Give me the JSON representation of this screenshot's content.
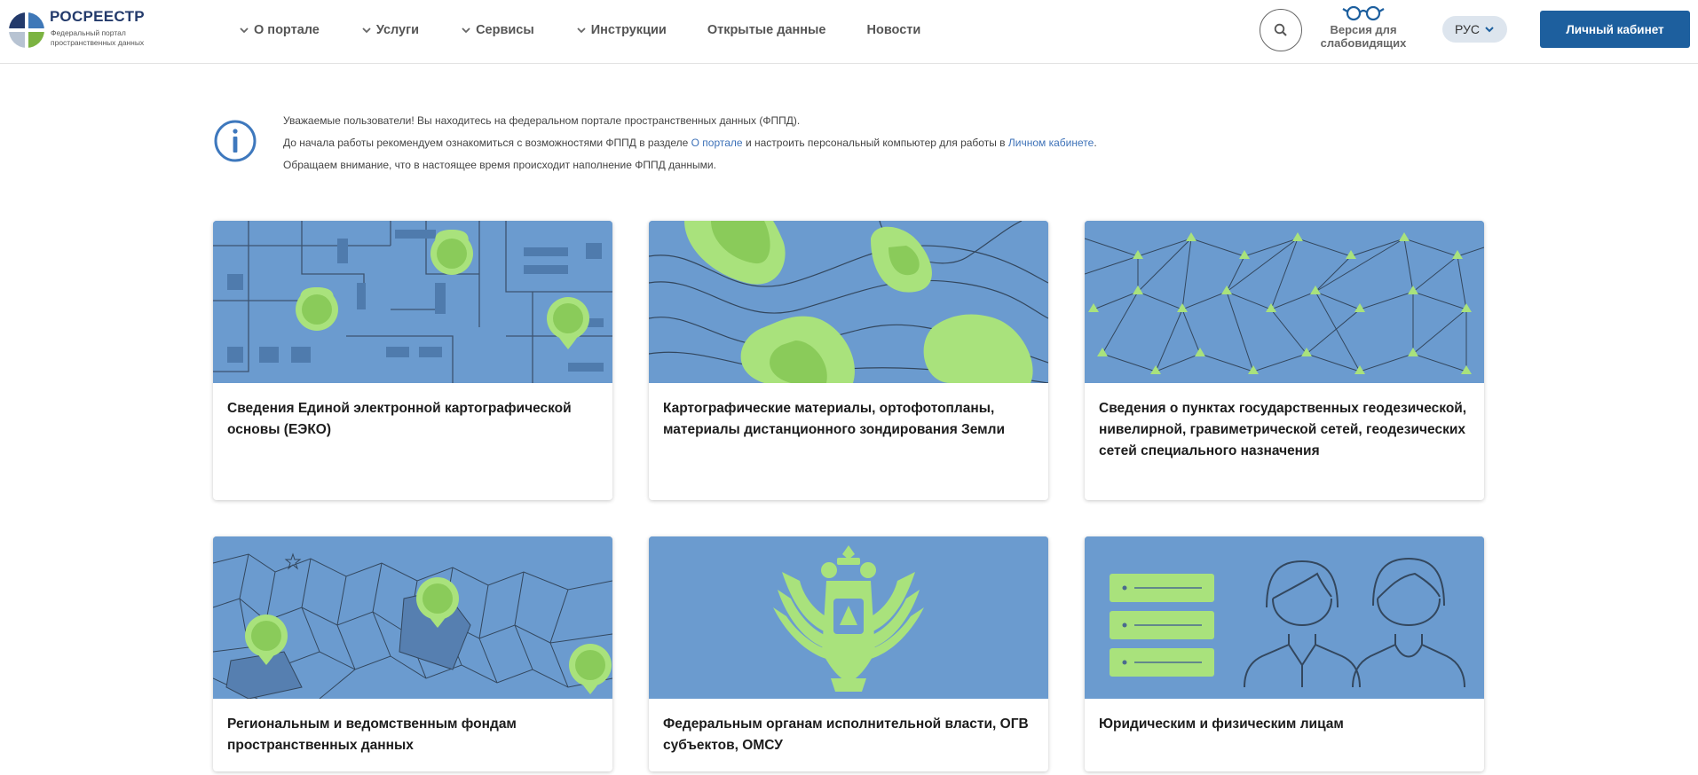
{
  "header": {
    "logo": {
      "title": "РОСРЕЕСТР",
      "subtitle": "Федеральный портал пространственных данных"
    },
    "nav": [
      {
        "label": "О портале",
        "dropdown": true
      },
      {
        "label": "Услуги",
        "dropdown": true
      },
      {
        "label": "Сервисы",
        "dropdown": true
      },
      {
        "label": "Инструкции",
        "dropdown": true
      },
      {
        "label": "Открытые данные",
        "dropdown": false
      },
      {
        "label": "Новости",
        "dropdown": false
      }
    ],
    "vision_label": "Версия для слабовидящих",
    "lang": "РУС",
    "cabinet_label": "Личный кабинет"
  },
  "info": {
    "line1": "Уважаемые пользователи! Вы находитесь на федеральном портале пространственных данных (ФППД).",
    "line2_pre": "До начала работы рекомендуем ознакомиться с возможностями ФППД в разделе ",
    "line2_link1": "О портале",
    "line2_mid": " и настроить персональный компьютер для работы в ",
    "line2_link2": "Личном кабинете",
    "line2_post": ".",
    "line3": "Обращаем внимание, что в настоящее время происходит наполнение ФППД данными."
  },
  "cards": [
    {
      "title": "Сведения Единой электронной картографической основы (ЕЭКО)"
    },
    {
      "title": "Картографические материалы, ортофотопланы, материалы дистанционного зондирования Земли"
    },
    {
      "title": "Сведения о пунктах государственных геодезической, нивелирной, гравиметрической сетей, геодезических сетей специального назначения"
    },
    {
      "title": "Региональным и ведомственным фондам пространственных данных"
    },
    {
      "title": "Федеральным органам исполнительной власти, ОГВ субъектов, ОМСУ"
    },
    {
      "title": "Юридическим и физическим лицам"
    }
  ],
  "colors": {
    "card_bg": "#6b9bcf",
    "accent_green": "#a9e27c",
    "primary_button": "#1d5f9e",
    "link": "#3e72b8"
  }
}
